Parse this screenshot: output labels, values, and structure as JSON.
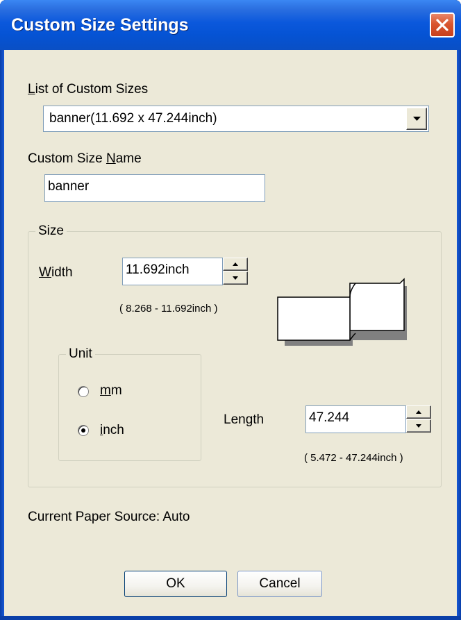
{
  "window": {
    "title": "Custom Size Settings"
  },
  "list_of_custom_sizes": {
    "label_prefix": "",
    "label_mnemonic": "L",
    "label_rest": "ist of Custom Sizes",
    "selected": "banner(11.692 x 47.244inch)"
  },
  "custom_size_name": {
    "label_prefix": "Custom Size ",
    "label_mnemonic": "N",
    "label_rest": "ame",
    "value": "banner"
  },
  "size_group": {
    "legend": "Size",
    "width": {
      "label_mnemonic": "W",
      "label_rest": "idth",
      "value": "11.692inch",
      "range": "( 8.268 - 11.692inch )"
    },
    "length": {
      "label_prefix": "Len",
      "label_mnemonic": "g",
      "label_rest": "th",
      "value": "47.244",
      "range": "( 5.472 - 47.244inch )"
    },
    "unit_group": {
      "legend": "Unit",
      "options": [
        {
          "label_mnemonic": "m",
          "label_rest": "m",
          "selected": false
        },
        {
          "label_mnemonic": "i",
          "label_rest": "nch",
          "selected": true
        }
      ]
    }
  },
  "paper_source": "Current Paper Source: Auto",
  "buttons": {
    "ok": "OK",
    "cancel": "Cancel"
  },
  "icons": {
    "close": "close-icon",
    "dropdown": "chevron-down-icon",
    "spin_up": "spin-up-icon",
    "spin_down": "spin-down-icon",
    "paper": "paper-illustration-icon"
  },
  "colors": {
    "titlebar": "#0553d4",
    "dialog_face": "#ece9d8",
    "close_button": "#d9562f"
  }
}
